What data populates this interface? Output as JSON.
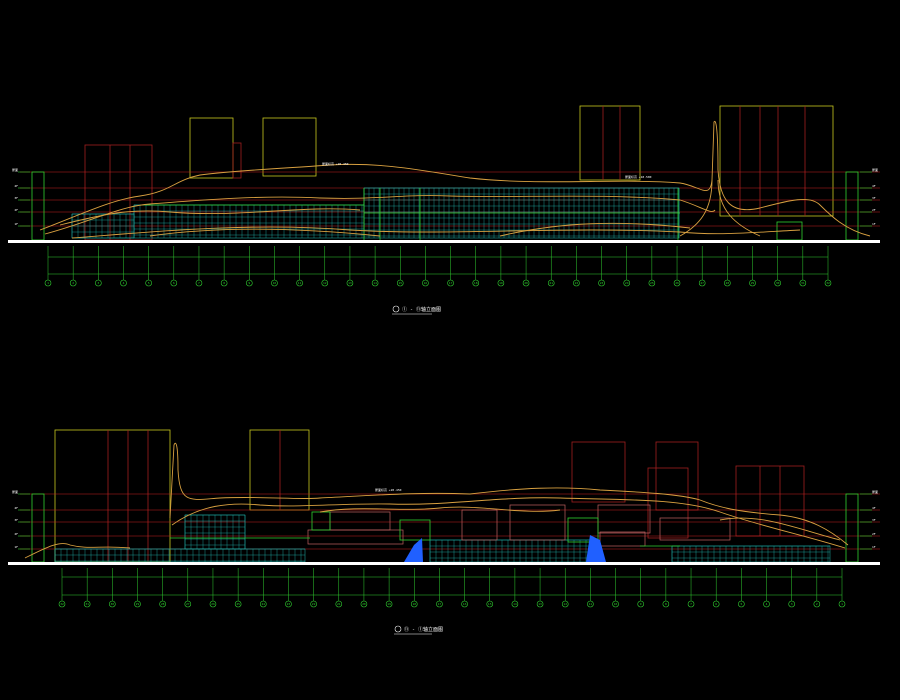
{
  "drawing": {
    "background": "#000000",
    "colors": {
      "building_outline": "#c8c820",
      "tower_dark": "#a02020",
      "datum_line": "#c82020",
      "roof_curve": "#d8a040",
      "facade_grid": "#20b8b0",
      "green_line": "#30d030",
      "ground": "#ffffff",
      "water_blue": "#2060ff",
      "label_text": "#ffffff"
    },
    "upper": {
      "title": "① - ⑪轴立面图",
      "level_tags_left": [
        "屋面",
        "4F",
        "3F",
        "2F",
        "1F"
      ],
      "level_tags_right": [
        "屋面",
        "4F",
        "3F",
        "2F",
        "1F"
      ],
      "annotations": [
        "屋面标高 +20.450",
        "屋面标高 +18.500"
      ],
      "axis_labels": [
        "1",
        "2",
        "3",
        "4",
        "5",
        "6",
        "7",
        "8",
        "9",
        "10",
        "11",
        "12",
        "13",
        "14",
        "15",
        "16",
        "17",
        "18",
        "19",
        "20",
        "21",
        "22",
        "23",
        "24",
        "25",
        "26",
        "27",
        "28",
        "29",
        "30",
        "31",
        "32"
      ]
    },
    "lower": {
      "title": "⑪ - ①轴立面图",
      "level_tags_left": [
        "屋面",
        "4F",
        "3F",
        "2F",
        "1F"
      ],
      "level_tags_right": [
        "屋面",
        "4F",
        "3F",
        "2F",
        "1F"
      ],
      "annotations": [
        "屋面标高 +20.450"
      ],
      "axis_labels": [
        "32",
        "31",
        "30",
        "29",
        "28",
        "27",
        "26",
        "25",
        "24",
        "23",
        "22",
        "21",
        "20",
        "19",
        "18",
        "17",
        "16",
        "15",
        "14",
        "13",
        "12",
        "11",
        "10",
        "9",
        "8",
        "7",
        "6",
        "5",
        "4",
        "3",
        "2",
        "1"
      ]
    }
  }
}
